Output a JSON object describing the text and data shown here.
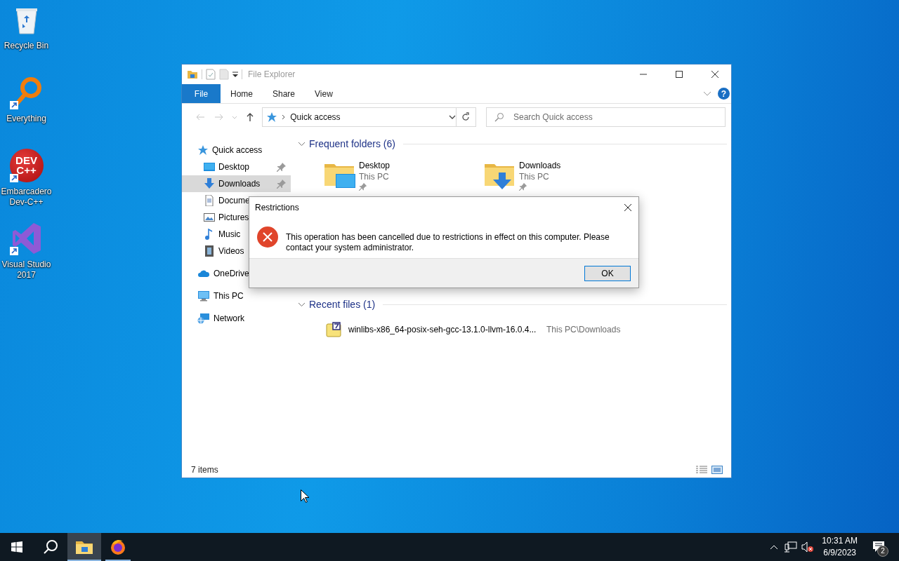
{
  "desktop_icons": [
    {
      "label": "Recycle Bin",
      "kind": "recycle",
      "shortcut": false
    },
    {
      "label": "Everything",
      "kind": "everything",
      "shortcut": true
    },
    {
      "label": "Embarcadero Dev-C++",
      "kind": "devcpp",
      "shortcut": true,
      "logo_text": [
        "DEV",
        "C++"
      ]
    },
    {
      "label": "Visual Studio 2017",
      "kind": "vs",
      "shortcut": true
    }
  ],
  "explorer": {
    "title": "File Explorer",
    "ribbon_tabs": [
      {
        "label": "File",
        "kind": "backstage"
      },
      {
        "label": "Home",
        "kind": "tab"
      },
      {
        "label": "Share",
        "kind": "tab"
      },
      {
        "label": "View",
        "kind": "tab"
      }
    ],
    "help": "?",
    "address": "Quick access",
    "search": {
      "placeholder": "Search Quick access"
    },
    "sidebar": [
      {
        "label": "Quick access",
        "kind": "quick",
        "selected": false,
        "pinned": false,
        "children": [
          {
            "label": "Desktop",
            "kind": "desktop",
            "selected": false,
            "pinned": true
          },
          {
            "label": "Downloads",
            "kind": "downloads",
            "selected": true,
            "pinned": true
          },
          {
            "label": "Docume",
            "kind": "documents",
            "selected": false
          },
          {
            "label": "Pictures",
            "kind": "pictures",
            "selected": false
          },
          {
            "label": "Music",
            "kind": "music",
            "selected": false
          },
          {
            "label": "Videos",
            "kind": "videos",
            "selected": false
          }
        ]
      },
      {
        "label": "OneDrive",
        "kind": "cloud",
        "selected": false
      },
      {
        "label": "This PC",
        "kind": "pc",
        "selected": false,
        "pinned": false
      },
      {
        "label": "Network",
        "kind": "network",
        "selected": false,
        "pinned": false
      }
    ],
    "sections": [
      {
        "title": "Frequent folders (6)",
        "expanded": true,
        "kind": "folders",
        "items": [
          {
            "name": "Desktop",
            "location": "This PC",
            "kind": "desktop",
            "pinned": true
          },
          {
            "name": "Downloads",
            "location": "This PC",
            "kind": "downloads",
            "pinned": true
          }
        ]
      },
      {
        "title": "Recent files (1)",
        "expanded": true,
        "kind": "files",
        "items": [
          {
            "name": "winlibs-x86_64-posix-seh-gcc-13.1.0-llvm-16.0.4...",
            "location": "This PC\\Downloads",
            "kind": "archive"
          }
        ]
      }
    ],
    "status": "7 items"
  },
  "dialog": {
    "title": "Restrictions",
    "message": "This operation has been cancelled due to restrictions in effect on this computer. Please contact your system administrator.",
    "button": "OK"
  },
  "taskbar": {
    "apps": [
      {
        "kind": "explorer",
        "selected": true
      },
      {
        "kind": "firefox",
        "selected": false
      }
    ],
    "muted": true,
    "time": "10:31 AM",
    "date": "6/9/2023",
    "notifications": "2"
  }
}
